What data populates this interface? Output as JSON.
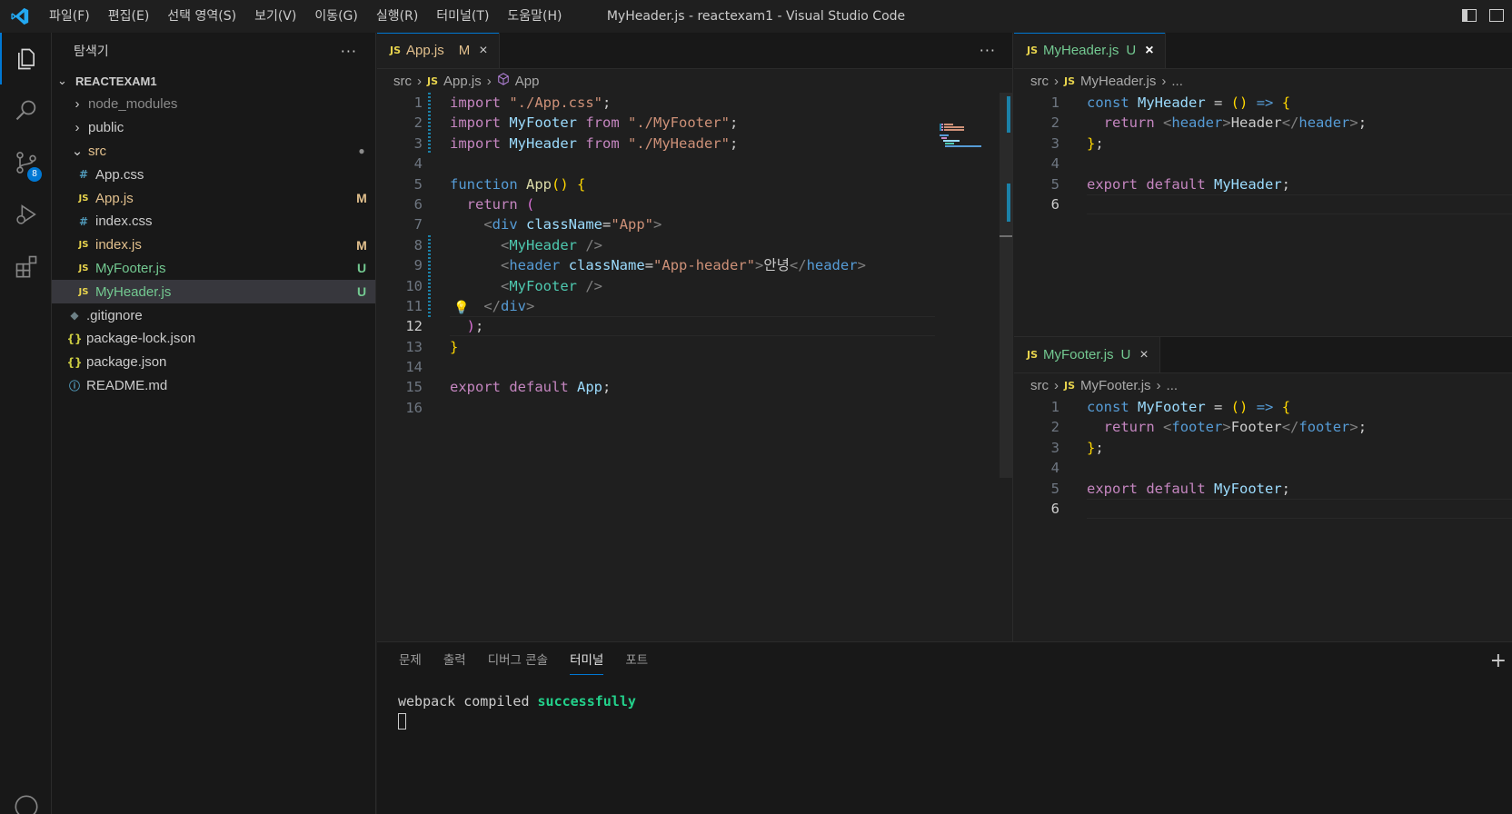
{
  "window": {
    "title": "MyHeader.js - reactexam1 - Visual Studio Code"
  },
  "menu": [
    "파일(F)",
    "편집(E)",
    "선택 영역(S)",
    "보기(V)",
    "이동(G)",
    "실행(R)",
    "터미널(T)",
    "도움말(H)"
  ],
  "activity": {
    "scm_badge": "8"
  },
  "sidebar": {
    "title": "탐색기",
    "more": "···",
    "root": "REACTEXAM1",
    "items": [
      {
        "name": "node_modules",
        "icon": "",
        "deco": "",
        "chev": "›"
      },
      {
        "name": "public",
        "icon": "",
        "deco": "",
        "chev": "›"
      },
      {
        "name": "src",
        "icon": "",
        "deco": "●",
        "chev": "⌄"
      },
      {
        "name": "App.css",
        "icon": "#",
        "deco": ""
      },
      {
        "name": "App.js",
        "icon": "JS",
        "deco": "M"
      },
      {
        "name": "index.css",
        "icon": "#",
        "deco": ""
      },
      {
        "name": "index.js",
        "icon": "JS",
        "deco": "M"
      },
      {
        "name": "MyFooter.js",
        "icon": "JS",
        "deco": "U"
      },
      {
        "name": "MyHeader.js",
        "icon": "JS",
        "deco": "U"
      },
      {
        "name": ".gitignore",
        "icon": "◆",
        "deco": ""
      },
      {
        "name": "package-lock.json",
        "icon": "{}",
        "deco": ""
      },
      {
        "name": "package.json",
        "icon": "{}",
        "deco": ""
      },
      {
        "name": "README.md",
        "icon": "ⓘ",
        "deco": ""
      }
    ]
  },
  "editor_left": {
    "tab_label": "App.js",
    "tab_status": "M",
    "tab_icon": "JS",
    "more": "···",
    "breadcrumb": [
      "src",
      "App.js",
      "App"
    ],
    "line_numbers": [
      "1",
      "2",
      "3",
      "4",
      "5",
      "6",
      "7",
      "8",
      "9",
      "10",
      "11",
      "12",
      "13",
      "14",
      "15",
      "16"
    ],
    "current_line": "12"
  },
  "editor_right_top": {
    "tab_label": "MyHeader.js",
    "tab_status": "U",
    "breadcrumb": [
      "src",
      "MyHeader.js",
      "..."
    ],
    "line_numbers": [
      "1",
      "2",
      "3",
      "4",
      "5",
      "6"
    ]
  },
  "editor_right_bottom": {
    "tab_label": "MyFooter.js",
    "tab_status": "U",
    "breadcrumb": [
      "src",
      "MyFooter.js",
      "..."
    ],
    "line_numbers": [
      "1",
      "2",
      "3",
      "4",
      "5",
      "6"
    ]
  },
  "panel": {
    "tabs": [
      "문제",
      "출력",
      "디버그 콘솔",
      "터미널",
      "포트"
    ],
    "active_tab": "터미널",
    "terminal_prefix": "webpack compiled ",
    "terminal_status": "successfully"
  },
  "colors": {
    "accent": "#0078d4",
    "modified": "#e2c08d",
    "untracked": "#73c991",
    "success": "#23d18b"
  }
}
